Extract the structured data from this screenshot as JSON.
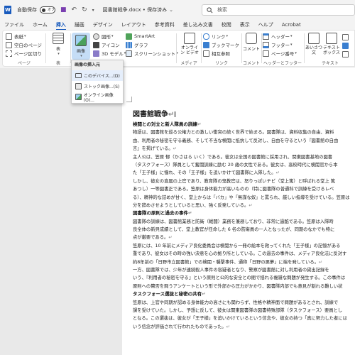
{
  "titlebar": {
    "autosave_label": "自動保存",
    "toggle_state": "オフ",
    "doc_title": "図書館戦争.docx • 保存済み",
    "dropdown_caret": "⌄"
  },
  "search": {
    "placeholder": "検索"
  },
  "tabs": [
    "ファイル",
    "ホーム",
    "挿入",
    "描画",
    "デザイン",
    "レイアウト",
    "参考資料",
    "差し込み文書",
    "校閲",
    "表示",
    "ヘルプ",
    "Acrobat"
  ],
  "active_tab": "挿入",
  "ribbon": {
    "pages": {
      "items": [
        "表紙",
        "空白のページ",
        "ページ区切り"
      ],
      "label": "ページ"
    },
    "table": {
      "button": "表",
      "label": "表"
    },
    "illustrations": {
      "picture_button": "画像",
      "items_col1": [
        "図形",
        "アイコン",
        "3D モデル"
      ],
      "items_col2": [
        "SmartArt",
        "グラフ",
        "スクリーンショット"
      ]
    },
    "media": {
      "button": "オンライン ビデオ",
      "label": "メディア"
    },
    "links": {
      "items": [
        "リンク",
        "ブックマーク",
        "相互参照"
      ],
      "label": "リンク"
    },
    "comments": {
      "button": "コメント",
      "label": "コメント"
    },
    "header_footer": {
      "items": [
        "ヘッダー",
        "フッター",
        "ページ番号"
      ],
      "label": "ヘッダーとフッター"
    },
    "text": {
      "buttons": [
        "あいさつ文",
        "テキスト ボックス"
      ],
      "label": "テキスト"
    }
  },
  "dropdown": {
    "header": "画像の挿入元",
    "items": [
      "このデバイス...(D)",
      "ストック画像...(S)",
      "オンライン画像(O)..."
    ]
  },
  "document": {
    "title": "図書館戦争",
    "pilcrow": "↵",
    "blocks": [
      {
        "type": "h",
        "text": "検閲との対立と新人隊員の訓練"
      },
      {
        "type": "p",
        "text": "物語は、図書館を巡る公権力との激しい衝突の続く世界で始まる。図書隊は、資料収集の自由、資料"
      },
      {
        "type": "p",
        "text": "由、利用者の秘密を守る義務、そして不当な検閲に抵抗して反対し、自由を守るという『図書館の自由"
      },
      {
        "type": "p",
        "text": "言』を掲げている。"
      },
      {
        "type": "p",
        "text": "主人公は、笠原 郁（かさはら いく）である。彼女は全国の図書館に採用され、関東図書基地の図書"
      },
      {
        "type": "p",
        "text": "（タスクフォース）隊員として奮闘訓練に励む 20 歳の女性である。彼女は、高校時代に検閲官から本"
      },
      {
        "type": "p",
        "text": "た「王子様」に憧れ、その「王子様」を追いかけて図書隊に入隊した。"
      },
      {
        "type": "p",
        "text": "しかし、彼女の直属の上官であり、教育隊の鬼教官は、怒りっぽいチビ（堂上篤）と呼ばれる堂上 篤"
      },
      {
        "type": "p",
        "text": "あつし）一等図書正である。笠原は身体能力が高いものの（特に図書隊の普通科で訓練を受けるレベ"
      },
      {
        "type": "p",
        "text": "る）、精神的な詰めが甘く、堂上からは「バカ」や「無謀な奴」と罵られ、厳しい指導を受けている。笠原は"
      },
      {
        "type": "p",
        "text": "分を辞めさせようとしていると思い、強く反発している。"
      },
      {
        "type": "h",
        "text": "図書隊の原則と過去の事件"
      },
      {
        "type": "p",
        "text": "図書隊の訓練は、図書館業務と防衛（戦闘）業務を兼務しており、非常に過酷である。笠原は入隊時"
      },
      {
        "type": "p",
        "text": "良全体の新貝成績として、堂上教官が任命した 6 名の防衛員の一人となったが、同期のなかでも特に"
      },
      {
        "type": "p",
        "text": "点が厳要である。"
      },
      {
        "type": "p",
        "text": "笠原には、10 年前にメディア良化委員会は検閲から一冊の絵本を救ってくれた「王子様」の記憶がある"
      },
      {
        "type": "p",
        "text": "重であり、彼女はその時の強い決意を心の拠り所としている。この過去の事件は、メディア良化法に反対す"
      },
      {
        "type": "p",
        "text": "約8年前の「日野市立図書館」での検閲・襲撃事件、通称「日野の悪夢」に端を発している。"
      },
      {
        "type": "p",
        "text": "一方、図書隊では、少年が連続殺人事件の容疑者となり、警察が図書館に対し利用者の貸出記録を"
      },
      {
        "type": "p",
        "text": "いう、『利用者の秘密を守る』という原則と公的な安全との間で揺れる複雑な問題が発生する。この事件は"
      },
      {
        "type": "p",
        "text": "原則への賛否を問うアンケートという形で外部から圧力がかかり、図書隊内部でも意見が割れる難しい状"
      },
      {
        "type": "h",
        "text": "タスクフォース選抜と秘密の共有"
      },
      {
        "type": "p",
        "text": "笠原は、上官や同期が認める身体能力の高さにも関わらず、性格や精神面で問題があるとされ、訓練で"
      },
      {
        "type": "p",
        "text": "課を受けていた。しかし、予想に反して、彼女は関東図書隊の図書特殊部隊（タスクフォース）要員とし"
      },
      {
        "type": "p",
        "text": "となる。この選抜は、彼女が「王子様」を追いかけているという信念や、彼女の持つ「真に努力した者には"
      },
      {
        "type": "p",
        "text": "いう信念が評価されて行われたものであった。"
      }
    ]
  },
  "colors": {
    "accent": "#185abd",
    "ribbon_bg": "#ffffff",
    "chrome_bg": "#f3f3f3",
    "doc_bg": "#e9e9e9"
  }
}
